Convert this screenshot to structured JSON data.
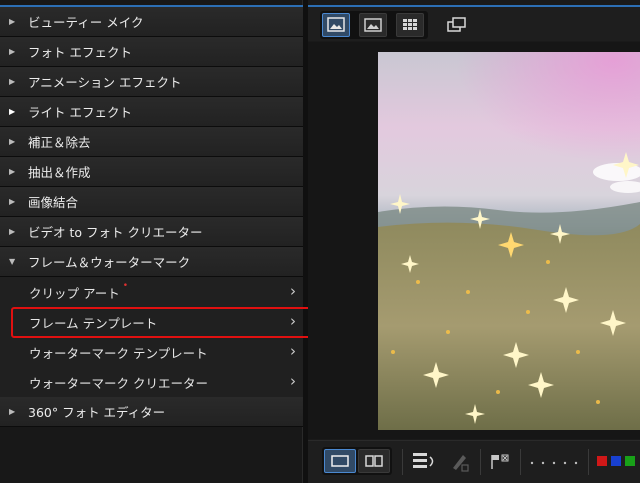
{
  "menu": {
    "items": [
      {
        "label": "ビューティー メイク",
        "expanded": false
      },
      {
        "label": "フォト エフェクト",
        "expanded": false
      },
      {
        "label": "アニメーション エフェクト",
        "expanded": false
      },
      {
        "label": "ライト エフェクト",
        "expanded": false
      },
      {
        "label": "補正＆除去",
        "expanded": false
      },
      {
        "label": "抽出＆作成",
        "expanded": false
      },
      {
        "label": "画像結合",
        "expanded": false
      },
      {
        "label": "ビデオ to フォト クリエーター",
        "expanded": false
      },
      {
        "label": "フレーム＆ウォーターマーク",
        "expanded": true
      },
      {
        "label": "360° フォト エディター",
        "expanded": false
      }
    ],
    "subitems": [
      {
        "label": "クリップ アート",
        "new_badge": true
      },
      {
        "label": "フレーム テンプレート",
        "highlighted": true
      },
      {
        "label": "ウォーターマーク テンプレート"
      },
      {
        "label": "ウォーターマーク クリエーター"
      }
    ]
  },
  "colors": {
    "accent": "#2c6fb5",
    "highlight_border": "#e01010",
    "swatches": [
      "#d01818",
      "#1840d0",
      "#18a018"
    ]
  },
  "icons": {
    "collapsed": "triangle-right",
    "expanded": "triangle-down",
    "submenu": "chevron-right"
  }
}
